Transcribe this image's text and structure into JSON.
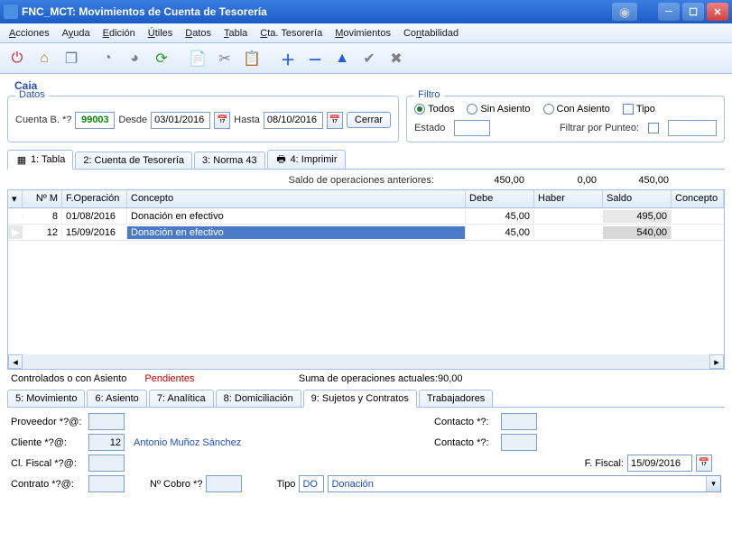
{
  "window": {
    "title": "FNC_MCT: Movimientos de Cuenta de Tesorería"
  },
  "menu": [
    "Acciones",
    "Ayuda",
    "Edición",
    "Útiles",
    "Datos",
    "Tabla",
    "Cta. Tesorería",
    "Movimientos",
    "Contabilidad"
  ],
  "section_label": "Caja",
  "datos": {
    "legend": "Datos",
    "cuenta_label": "Cuenta B. *?",
    "cuenta_value": "99003",
    "desde_label": "Desde",
    "desde_value": "03/01/2016",
    "hasta_label": "Hasta",
    "hasta_value": "08/10/2016",
    "cerrar": "Cerrar"
  },
  "filtro": {
    "legend": "Filtro",
    "todos": "Todos",
    "sin_asiento": "Sin Asiento",
    "con_asiento": "Con Asiento",
    "tipo": "Tipo",
    "estado": "Estado",
    "filtrar_punteo": "Filtrar por Punteo:"
  },
  "tabs_main": {
    "t1": "1: Tabla",
    "t2": "2: Cuenta de Tesorería",
    "t3": "3: Norma 43",
    "t4": "4: Imprimir"
  },
  "summary_top": {
    "label": "Saldo de operaciones anteriores:",
    "v1": "450,00",
    "v2": "0,00",
    "v3": "450,00"
  },
  "table": {
    "headers": {
      "num": "Nº M",
      "fop": "F.Operación",
      "concepto": "Concepto",
      "debe": "Debe",
      "haber": "Haber",
      "saldo": "Saldo",
      "concepto2": "Concepto"
    },
    "rows": [
      {
        "num": "8",
        "fop": "01/08/2016",
        "concepto": "Donación en efectivo",
        "debe": "45,00",
        "haber": "",
        "saldo": "495,00"
      },
      {
        "num": "12",
        "fop": "15/09/2016",
        "concepto": "Donación en efectivo",
        "debe": "45,00",
        "haber": "",
        "saldo": "540,00"
      }
    ]
  },
  "footer_sum": {
    "controlados": "Controlados o con Asiento",
    "pendientes": "Pendientes",
    "suma_label": "Suma de operaciones actuales:",
    "suma_value": "90,00"
  },
  "tabs_bottom": {
    "t5": "5: Movimiento",
    "t6": "6: Asiento",
    "t7": "7: Analítica",
    "t8": "8: Domiciliación",
    "t9": "9: Sujetos y Contratos",
    "t10": "Trabajadores"
  },
  "bform": {
    "proveedor_lbl": "Proveedor *?@:",
    "cliente_lbl": "Cliente *?@:",
    "cliente_val": "12",
    "cliente_name": "Antonio Muñoz Sánchez",
    "clfiscal_lbl": "Cl. Fiscal *?@:",
    "contrato_lbl": "Contrato *?@:",
    "ncobro_lbl": "Nº Cobro *?",
    "tipo_lbl": "Tipo",
    "tipo_val": "DO",
    "tipo_desc": "Donación",
    "contacto_lbl": "Contacto *?:",
    "ffiscal_lbl": "F. Fiscal:",
    "ffiscal_val": "15/09/2016"
  }
}
